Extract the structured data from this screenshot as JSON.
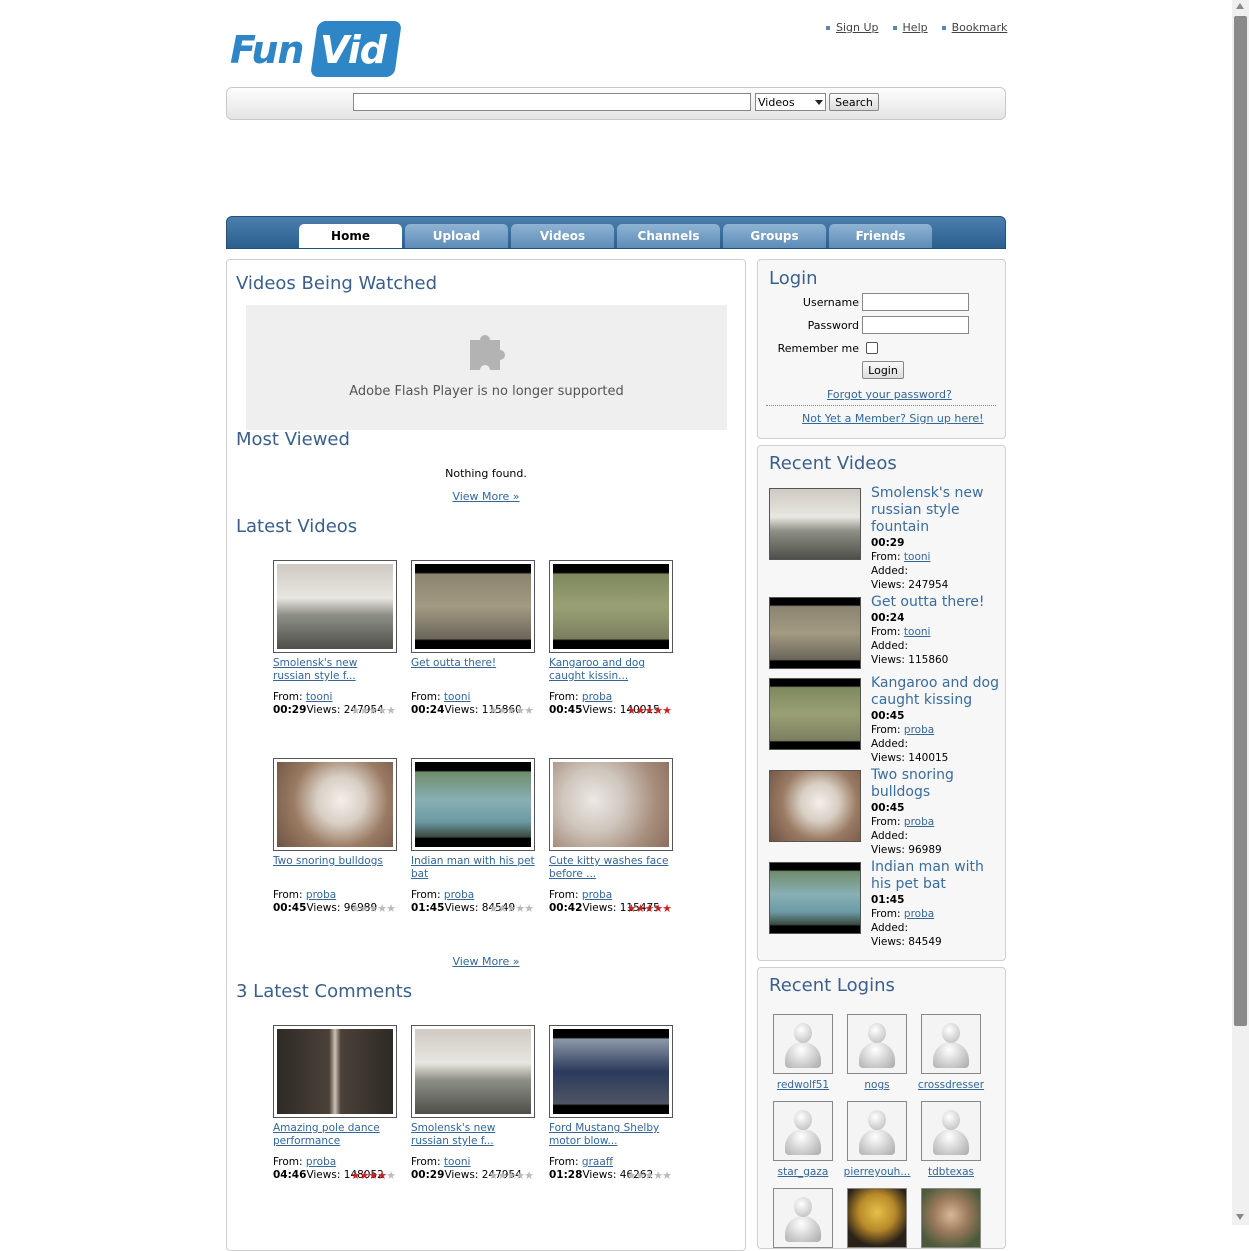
{
  "header": {
    "logo": {
      "part1": "Fun",
      "part2": "Vid"
    },
    "top_links": [
      "Sign Up",
      "Help",
      "Bookmark"
    ]
  },
  "search": {
    "placeholder": "",
    "category": "Videos",
    "button": "Search"
  },
  "nav": {
    "tabs": [
      {
        "label": "Home",
        "active": true
      },
      {
        "label": "Upload",
        "active": false
      },
      {
        "label": "Videos",
        "active": false
      },
      {
        "label": "Channels",
        "active": false
      },
      {
        "label": "Groups",
        "active": false
      },
      {
        "label": "Friends",
        "active": false
      }
    ]
  },
  "main": {
    "watched": {
      "heading": "Videos Being Watched",
      "flash_message": "Adobe Flash Player is no longer supported"
    },
    "most_viewed": {
      "heading": "Most Viewed",
      "empty": "Nothing found.",
      "view_more": "View More »"
    },
    "latest": {
      "heading": "Latest Videos",
      "view_more": "View More »",
      "items": [
        {
          "title": "Smolensk's new russian style f...",
          "from_label": "From:",
          "user": "tooni",
          "duration": "00:29",
          "views_label": "Views:",
          "views": "247954",
          "rating": 0
        },
        {
          "title": "Get outta there!",
          "from_label": "From:",
          "user": "tooni",
          "duration": "00:24",
          "views_label": "Views:",
          "views": "115860",
          "rating": 0
        },
        {
          "title": "Kangaroo and dog caught kissin...",
          "from_label": "From:",
          "user": "proba",
          "duration": "00:45",
          "views_label": "Views:",
          "views": "140015",
          "rating": 5
        },
        {
          "title": "Two snoring bulldogs",
          "from_label": "From:",
          "user": "proba",
          "duration": "00:45",
          "views_label": "Views:",
          "views": "96989",
          "rating": 0
        },
        {
          "title": "Indian man with his pet bat",
          "from_label": "From:",
          "user": "proba",
          "duration": "01:45",
          "views_label": "Views:",
          "views": "84549",
          "rating": 0
        },
        {
          "title": "Cute kitty washes face before ...",
          "from_label": "From:",
          "user": "proba",
          "duration": "00:42",
          "views_label": "Views:",
          "views": "115475",
          "rating": 5
        }
      ]
    },
    "comments": {
      "heading": "3 Latest Comments",
      "items": [
        {
          "title": "Amazing pole dance performance",
          "from_label": "From:",
          "user": "proba",
          "duration": "04:46",
          "views_label": "Views:",
          "views": "148052",
          "rating": 4
        },
        {
          "title": "Smolensk's new russian style f...",
          "from_label": "From:",
          "user": "tooni",
          "duration": "00:29",
          "views_label": "Views:",
          "views": "247954",
          "rating": 0
        },
        {
          "title": "Ford Mustang Shelby motor blow...",
          "from_label": "From:",
          "user": "graaff",
          "duration": "01:28",
          "views_label": "Views:",
          "views": "46262",
          "rating": 0
        }
      ]
    }
  },
  "login": {
    "heading": "Login",
    "username_label": "Username",
    "password_label": "Password",
    "remember_label": "Remember me",
    "button": "Login",
    "forgot": "Forgot your password?",
    "signup": "Not Yet a Member? Sign up here!"
  },
  "recent_videos": {
    "heading": "Recent Videos",
    "from_label": "From:",
    "added_label": "Added:",
    "views_label": "Views:",
    "items": [
      {
        "title": "Smolensk's new russian style fountain",
        "duration": "00:29",
        "user": "tooni",
        "views": "247954"
      },
      {
        "title": "Get outta there!",
        "duration": "00:24",
        "user": "tooni",
        "views": "115860"
      },
      {
        "title": "Kangaroo and dog caught kissing",
        "duration": "00:45",
        "user": "proba",
        "views": "140015"
      },
      {
        "title": "Two snoring bulldogs",
        "duration": "00:45",
        "user": "proba",
        "views": "96989"
      },
      {
        "title": "Indian man with his pet bat",
        "duration": "01:45",
        "user": "proba",
        "views": "84549"
      }
    ]
  },
  "recent_logins": {
    "heading": "Recent Logins",
    "users": [
      "redwolf51",
      "nogs",
      "crossdresser",
      "star_gaza",
      "pierreyouh...",
      "tdbtexas"
    ]
  },
  "colors": {
    "accent": "#3a5f8c",
    "link": "#336699",
    "nav": "#2b5f8e",
    "star_on": "#cc2222",
    "star_off": "#bbbbbb"
  }
}
